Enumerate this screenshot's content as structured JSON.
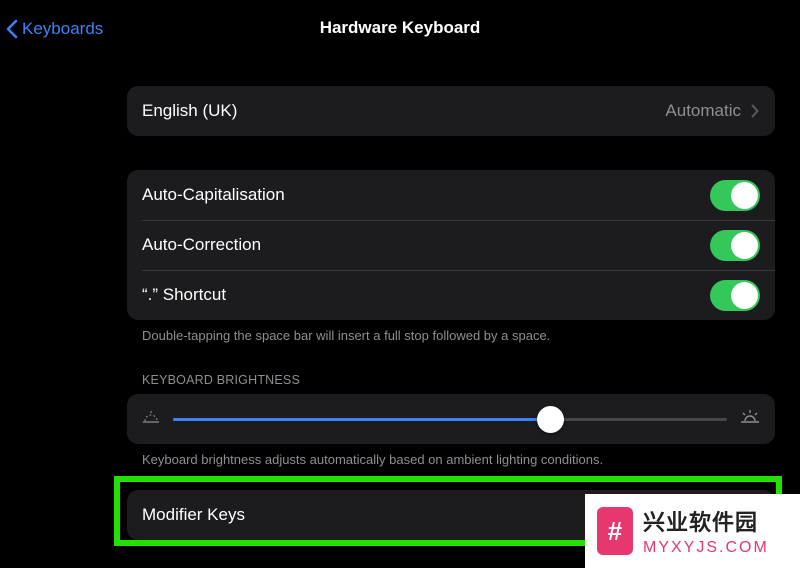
{
  "nav": {
    "back_label": "Keyboards",
    "title": "Hardware Keyboard"
  },
  "language": {
    "label": "English (UK)",
    "value": "Automatic"
  },
  "toggles": [
    {
      "label": "Auto-Capitalisation",
      "on": true
    },
    {
      "label": "Auto-Correction",
      "on": true
    },
    {
      "label": "“.” Shortcut",
      "on": true
    }
  ],
  "shortcut_footnote": "Double-tapping the space bar will insert a full stop followed by a space.",
  "brightness": {
    "header": "KEYBOARD BRIGHTNESS",
    "level": 0.68,
    "footnote": "Keyboard brightness adjusts automatically based on ambient lighting conditions."
  },
  "modifier_keys": {
    "label": "Modifier Keys"
  },
  "colors": {
    "accent": "#3b82f6",
    "toggle_on": "#34c759",
    "highlight": "#22e000"
  },
  "watermark": {
    "logo_glyph": "#",
    "cn": "兴业软件园",
    "en": "MYXYJS.COM"
  }
}
